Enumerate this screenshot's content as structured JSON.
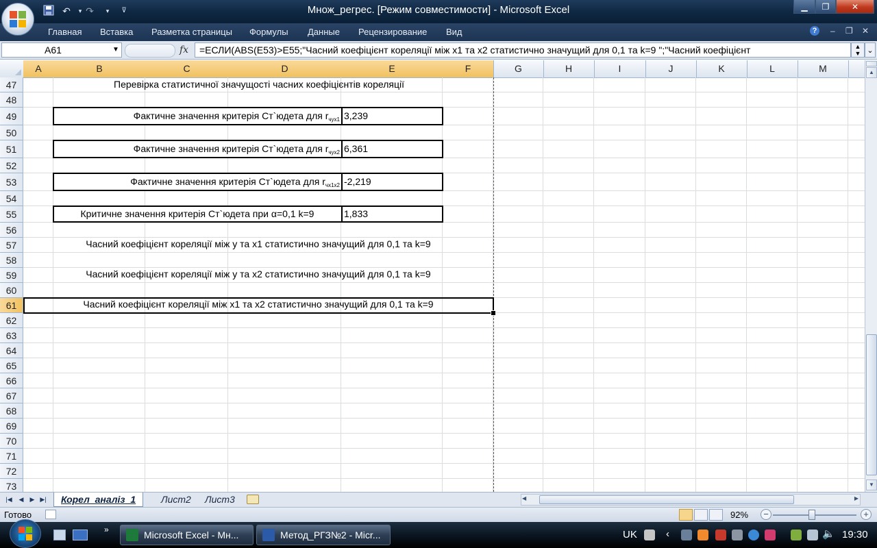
{
  "window": {
    "title": "Множ_регрес.  [Режим совместимости] - Microsoft Excel",
    "controls": {
      "minimize": "▁",
      "maximize": "❐",
      "close": "✕"
    }
  },
  "ribbon": {
    "tabs": [
      "Главная",
      "Вставка",
      "Разметка страницы",
      "Формулы",
      "Данные",
      "Рецензирование",
      "Вид"
    ],
    "help": "?",
    "wb_controls": [
      "–",
      "❐",
      "✕"
    ]
  },
  "formula_bar": {
    "name_box": "A61",
    "fx": "fx",
    "formula": "=ЕСЛИ(ABS(E53)>E55;\"Часний коефіцієнт кореляції між x1 та x2 статистично значущий для 0,1 та k=9 \";\"Часний коефіцієнт"
  },
  "columns": [
    "A",
    "B",
    "C",
    "D",
    "E",
    "F",
    "G",
    "H",
    "I",
    "J",
    "K",
    "L",
    "M"
  ],
  "rows": [
    "47",
    "48",
    "49",
    "50",
    "51",
    "52",
    "53",
    "54",
    "55",
    "56",
    "57",
    "58",
    "59",
    "60",
    "61",
    "62",
    "63",
    "64",
    "65",
    "66",
    "67",
    "68",
    "69",
    "70",
    "71",
    "72",
    "73"
  ],
  "cells": {
    "r47": "Перевірка статистичної значущості часних коефіцієнтів кореляції",
    "r49_label": "Фактичне значення критерія Ст`юдета для r",
    "r49_sub": "чух1",
    "r49_value": "3,239",
    "r51_label": "Фактичне значення критерія Ст`юдета для r",
    "r51_sub": "чух2",
    "r51_value": "6,361",
    "r53_label": "Фактичне значення критерія Ст`юдета для r",
    "r53_sub": "чх1х2",
    "r53_value": "-2,219",
    "r55_label": "Критичне значення критерія Ст`юдета при α=0,1 k=9",
    "r55_value": "1,833",
    "r57": "Часний коефіцієнт кореляції між у та х1 статистично значущий для 0,1 та k=9",
    "r59": "Часний коефіцієнт кореляції між у та х2 статистично значущий для 0,1 та k=9",
    "r61": "Часний коефіцієнт кореляції між х1 та х2 статистично значущий для 0,1 та k=9"
  },
  "sheets": [
    "Корел_аналіз_1",
    "Лист2",
    "Лист3"
  ],
  "active_sheet": "Корел_аналіз_1",
  "status": {
    "ready": "Готово",
    "zoom": "92%",
    "zoom_level_percent": 92
  },
  "taskbar": {
    "items": [
      {
        "label": "Microsoft Excel - Мн..."
      },
      {
        "label": "Метод_РГЗ№2 - Micr..."
      }
    ],
    "language": "UK",
    "clock": "19:30"
  },
  "colors": {
    "title_bg": "#0f2843",
    "selected_header": "#f1c15f",
    "excel_green": "#1d7a3a",
    "word_blue": "#2b5aa8"
  }
}
